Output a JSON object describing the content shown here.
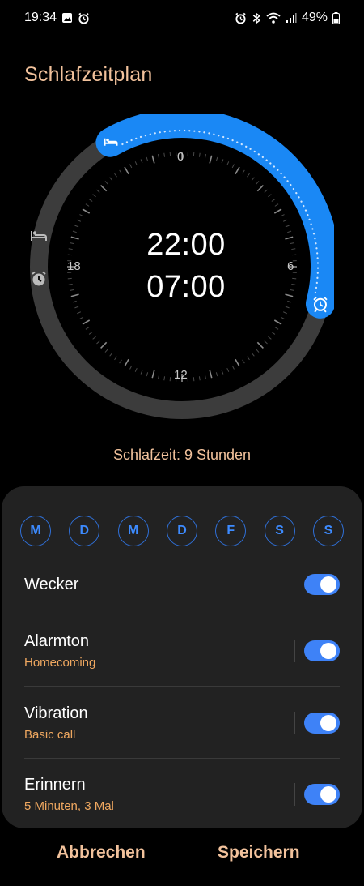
{
  "status_bar": {
    "time": "19:34",
    "battery": "49%",
    "left_icons": [
      "image-icon",
      "alarm-icon"
    ],
    "right_icons": [
      "alarm-icon",
      "bluetooth-icon",
      "wifi-icon",
      "signal-icon",
      "battery-icon"
    ]
  },
  "title": "Schlafzeitplan",
  "dial": {
    "bedtime": "22:00",
    "wake_time": "07:00",
    "labels": {
      "top": "0",
      "right": "6",
      "bottom": "12",
      "left": "18"
    },
    "bed_icon": "bed-icon",
    "wake_icon": "alarm-clock-icon",
    "colors": {
      "arc": "#1a88f5",
      "track": "#3c3c3c",
      "face": "#000000"
    }
  },
  "sleep_duration": "Schlafzeit: 9 Stunden",
  "days": [
    "M",
    "D",
    "M",
    "D",
    "F",
    "S",
    "S"
  ],
  "settings": {
    "wecker": {
      "title": "Wecker",
      "enabled": true
    },
    "alarmton": {
      "title": "Alarmton",
      "subtitle": "Homecoming",
      "enabled": true
    },
    "vibration": {
      "title": "Vibration",
      "subtitle": "Basic call",
      "enabled": true
    },
    "erinnern": {
      "title": "Erinnern",
      "subtitle": "5 Minuten, 3 Mal",
      "enabled": true
    }
  },
  "buttons": {
    "cancel": "Abbrechen",
    "save": "Speichern"
  },
  "colors": {
    "accent": "#f2c29c",
    "subtitle": "#f0a860",
    "toggle_on": "#3e82f7",
    "day_blue": "#3d8bff"
  }
}
